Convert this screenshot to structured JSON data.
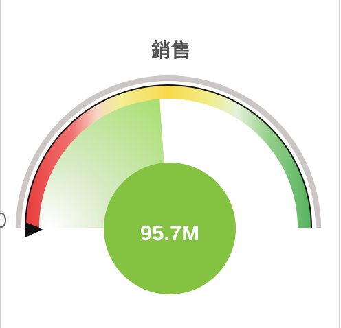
{
  "chart_data": {
    "type": "gauge",
    "title": "銷售",
    "value": 95.7,
    "value_label": "95.7M",
    "unit": "M",
    "min": 0,
    "max": 200,
    "band_colors": [
      "#e84545",
      "#f5e06a",
      "#5cb360"
    ],
    "fill_color": "#a6dd6c",
    "center_circle_color": "#84c242"
  }
}
